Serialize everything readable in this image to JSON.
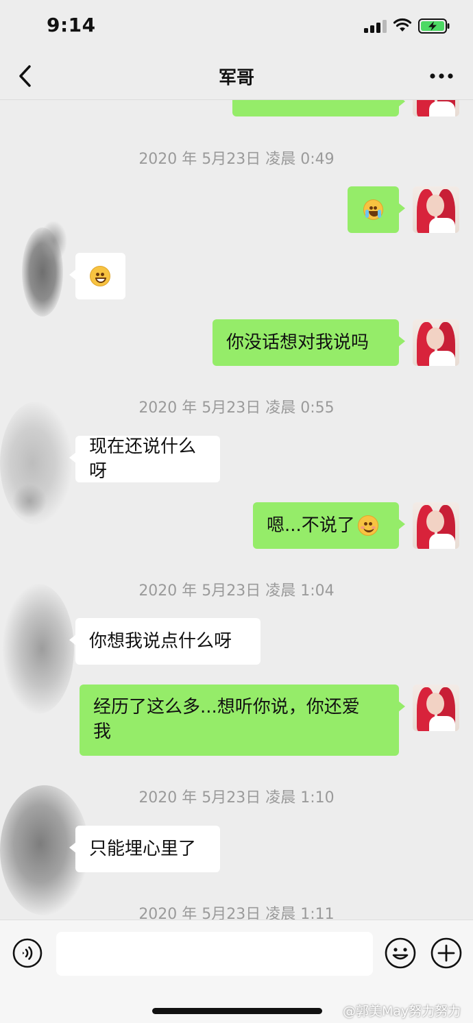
{
  "status_bar": {
    "time": "9:14"
  },
  "nav": {
    "title": "军哥"
  },
  "messages": [
    {
      "type": "time",
      "text": "2020 年 5月23日 凌晨 0:49"
    },
    {
      "type": "me",
      "emoji": "grin-tears"
    },
    {
      "type": "other",
      "emoji": "grin"
    },
    {
      "type": "me",
      "text": "你没话想对我说吗"
    },
    {
      "type": "time",
      "text": "2020 年 5月23日 凌晨 0:55"
    },
    {
      "type": "other",
      "text": "现在还说什么呀"
    },
    {
      "type": "me",
      "text": "嗯...不说了",
      "emoji": "smile"
    },
    {
      "type": "time",
      "text": "2020 年 5月23日 凌晨 1:04"
    },
    {
      "type": "other",
      "text": "你想我说点什么呀"
    },
    {
      "type": "me",
      "line1": "经历了这么多...想听你说，你还爱",
      "line2": "我"
    },
    {
      "type": "time",
      "text": "2020 年 5月23日 凌晨 1:10"
    },
    {
      "type": "other",
      "text": "只能埋心里了"
    },
    {
      "type": "time",
      "text": "2020 年 5月23日 凌晨 1:11"
    }
  ],
  "input": {
    "placeholder": ""
  },
  "watermark": "@郭美May努力努力",
  "colors": {
    "bubble_me": "#95ec69",
    "bubble_other": "#ffffff",
    "background": "#ededed"
  },
  "icons": [
    "back-arrow-icon",
    "more-dots-icon",
    "voice-icon",
    "emoji-icon",
    "plus-icon"
  ]
}
